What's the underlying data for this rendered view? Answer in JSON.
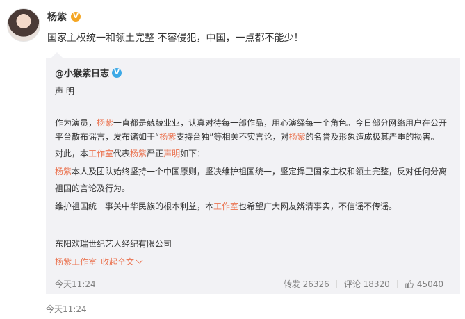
{
  "post": {
    "author": "杨紫",
    "badge": "V",
    "text": "国家主权统一和领土完整 不容侵犯，中国，一点都不能少！",
    "time": "今天11:24"
  },
  "repost": {
    "author": "@小猴紫日志",
    "badge": "V",
    "heading": "声 明",
    "lines": [
      [
        "作为演员，",
        "杨紫",
        "一直都是兢兢业业，认真对待每一部作品，用心演绎每一个角色。今日部分网络用户在公开"
      ],
      [
        "平台散布谣言，发布诸如于“",
        "杨紫",
        "支持台独”等相关不实言论，对",
        "杨紫",
        "的名誉及形象造成极其严重的损害。"
      ],
      [
        "对此，本",
        "工作室",
        "代表",
        "杨紫",
        "严正",
        "声明",
        "如下："
      ],
      [
        "杨紫",
        "本人及团队始终坚持一个中国原则，坚决维护祖国统一，坚定捍卫国家主权和领土完整，反对任何分离"
      ],
      [
        "祖国的言论及行为。"
      ],
      [
        "维护祖国统一事关中华民族的根本利益，本",
        "工作室",
        "也希望广大网友辨清事实，不信谣不传谣。"
      ]
    ],
    "company": "东阳欢瑞世纪艺人经纪有限公司",
    "signature": "杨紫工作室",
    "collapse_label": "收起全文",
    "time": "今天11:24",
    "reposts": "转发 26326",
    "comments": "评论 18320",
    "likes": "45040"
  },
  "colors": {
    "highlight": "#eb7350",
    "card_bg": "#f2f2f5",
    "muted": "#808080"
  }
}
